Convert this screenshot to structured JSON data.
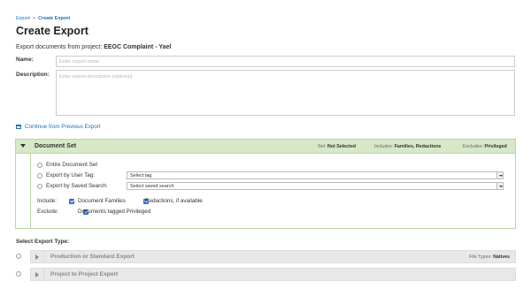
{
  "breadcrumb": {
    "root": "Export",
    "separator": ">",
    "current": "Create Export"
  },
  "page_title": "Create Export",
  "subtitle": {
    "prefix": "Export documents from project:",
    "project": "EEOC Complaint - Yael"
  },
  "form": {
    "name_label": "Name:",
    "name_placeholder": "Enter export name",
    "description_label": "Description:",
    "description_placeholder": "Enter export description (optional)"
  },
  "continue_link": "Continue from Previous Export",
  "document_set": {
    "title": "Document Set",
    "set_label": "Set:",
    "set_value": "Not Selected",
    "includes_label": "Includes:",
    "includes_value": "Families, Redactions",
    "excludes_label": "Excludes:",
    "excludes_value": "Privileged",
    "options": [
      {
        "label": "Entire Document Set"
      },
      {
        "label": "Export by User Tag:",
        "select_value": "Select tag"
      },
      {
        "label": "Export by Saved Search:",
        "select_value": "Select saved search"
      }
    ],
    "include_label": "Include:",
    "include_items": [
      "Document Families",
      "Redactions, if available"
    ],
    "exclude_label": "Exclude:",
    "exclude_items": [
      "Documents tagged Privileged"
    ]
  },
  "export_type": {
    "heading": "Select Export Type:",
    "rows": [
      {
        "label": "Production or Standard Export",
        "meta_label": "File Types:",
        "meta_value": "Natives"
      },
      {
        "label": "Project to Project Export"
      }
    ]
  },
  "colors": {
    "accent": "#1f6fb4",
    "docset_header": "#d6e8c6",
    "docset_border": "#b9d6a3",
    "checkbox": "#2a6fc9",
    "type_row": "#e8e8e8"
  }
}
